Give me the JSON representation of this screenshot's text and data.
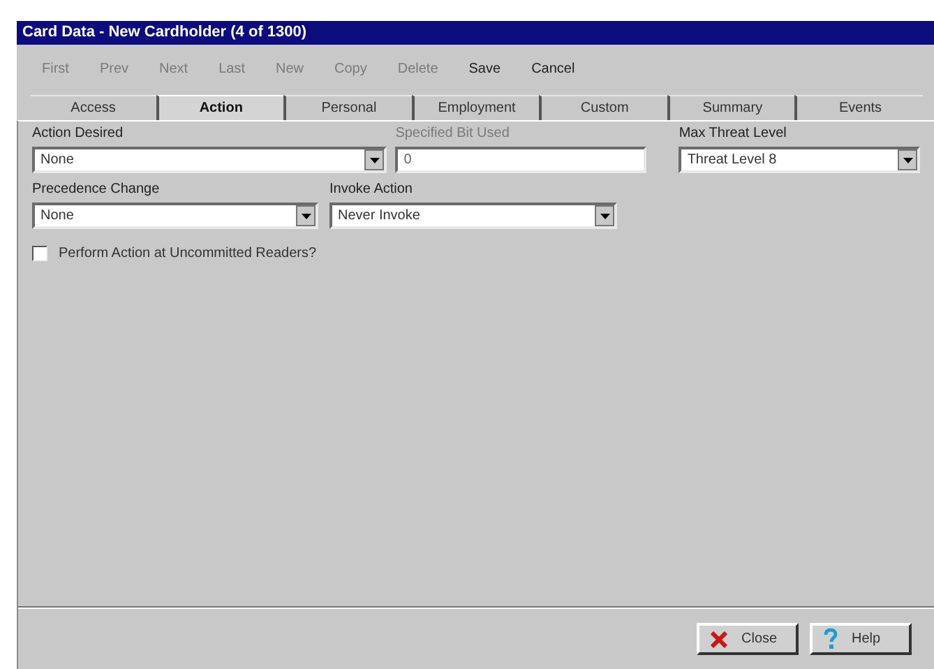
{
  "window": {
    "title": "Card Data - New Cardholder (4 of 1300)"
  },
  "toolbar": [
    {
      "label": "First",
      "disabled": true
    },
    {
      "label": "Prev",
      "disabled": true
    },
    {
      "label": "Next",
      "disabled": true
    },
    {
      "label": "Last",
      "disabled": true
    },
    {
      "label": "New",
      "disabled": true
    },
    {
      "label": "Copy",
      "disabled": true
    },
    {
      "label": "Delete",
      "disabled": true
    },
    {
      "label": "Save",
      "disabled": false
    },
    {
      "label": "Cancel",
      "disabled": false
    }
  ],
  "tabs": [
    {
      "label": "Access",
      "selected": false
    },
    {
      "label": "Action",
      "selected": true
    },
    {
      "label": "Personal",
      "selected": false
    },
    {
      "label": "Employment",
      "selected": false
    },
    {
      "label": "Custom",
      "selected": false
    },
    {
      "label": "Summary",
      "selected": false
    },
    {
      "label": "Events",
      "selected": false
    }
  ],
  "fields": [
    {
      "label": "Action Desired",
      "value": "None",
      "kind": "dropdown",
      "disabled": false
    },
    {
      "label": "Specified Bit Used",
      "value": "0",
      "kind": "text",
      "disabled": true
    },
    {
      "label": "Max Threat Level",
      "value": "Threat Level 8",
      "kind": "dropdown",
      "disabled": false
    },
    {
      "label": "Precedence Change",
      "value": "None",
      "kind": "dropdown",
      "disabled": false
    },
    {
      "label": "Invoke Action",
      "value": "Never Invoke",
      "kind": "dropdown",
      "disabled": false
    }
  ],
  "checkbox": {
    "label": "Perform Action at Uncommitted Readers?",
    "checked": false
  },
  "buttons": [
    {
      "label": "Close",
      "kind": "close"
    },
    {
      "label": "Help",
      "kind": "help"
    }
  ]
}
